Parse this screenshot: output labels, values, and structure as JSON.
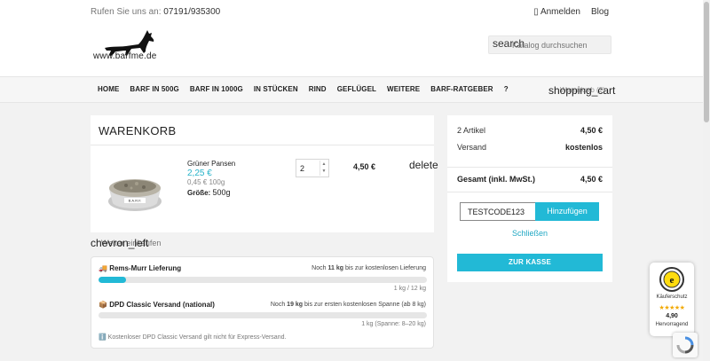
{
  "header": {
    "phone_label": "Rufen Sie uns an:",
    "phone_number": "07191/935300",
    "login_label": "Anmelden",
    "blog_label": "Blog",
    "logo_text": "www.barfme.de",
    "search_icon_name": "search",
    "search_placeholder": "Katalog durchsuchen"
  },
  "nav": {
    "items": [
      "HOME",
      "BARF IN 500G",
      "BARF IN 1000G",
      "IN STÜCKEN",
      "RIND",
      "GEFLÜGEL",
      "WEITERE",
      "BARF-RATGEBER",
      "?"
    ],
    "cart_icon_name": "shopping_cart",
    "cart_count": "Warenkorb (2)"
  },
  "cart": {
    "title": "WARENKORB",
    "product": {
      "name": "Grüner Pansen",
      "price": "2,25 €",
      "unit_price": "0,45 € 100g",
      "size_label": "Größe:",
      "size_value": "500g",
      "quantity": "2",
      "line_total": "4,50 €",
      "delete_icon_name": "delete"
    },
    "continue_icon_name": "chevron_left",
    "continue_label": "Weiter einkaufen"
  },
  "shipping": {
    "rows": [
      {
        "icon": "🚚",
        "title": "Rems-Murr Lieferung",
        "note_prefix": "Noch",
        "note_amount": "11 kg",
        "note_suffix": "bis zur kostenlosen Lieferung",
        "progress": 0.083,
        "caption": "1 kg / 12 kg"
      },
      {
        "icon": "📦",
        "title": "DPD Classic Versand (national)",
        "note_prefix": "Noch",
        "note_amount": "19 kg",
        "note_suffix": "bis zur ersten kostenlosen Spanne (ab 8 kg)",
        "progress": 0.0,
        "caption": "1 kg (Spanne: 8–20 kg)"
      }
    ],
    "footnote_icon": "ℹ️",
    "footnote": "Kostenloser DPD Classic Versand gilt nicht für Express-Versand."
  },
  "summary": {
    "items_label": "2 Artikel",
    "items_value": "4,50 €",
    "shipping_label": "Versand",
    "shipping_value": "kostenlos",
    "total_label": "Gesamt (inkl. MwSt.)",
    "total_value": "4,50 €",
    "voucher_value": "TESTCODE123",
    "voucher_button": "Hinzufügen",
    "close_label": "Schließen",
    "checkout_label": "ZUR KASSE"
  },
  "trust": {
    "label": "Käuferschutz",
    "stars": "★★★★★",
    "score": "4,90",
    "rating": "Hervorragend"
  },
  "colors": {
    "accent": "#22b9d6",
    "link": "#22a8c4"
  }
}
